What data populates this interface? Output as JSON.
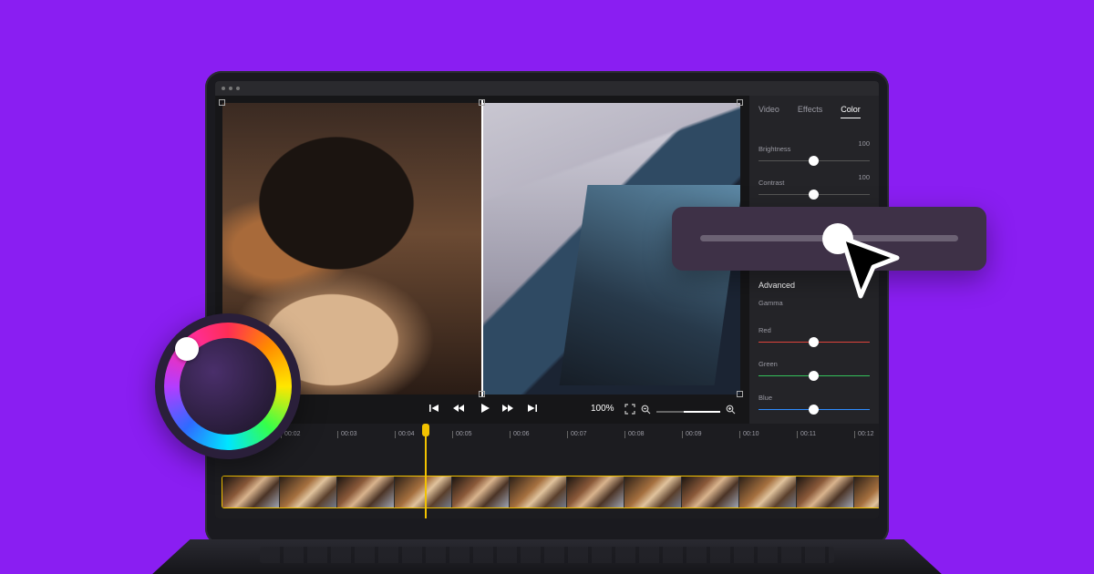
{
  "panel": {
    "tabs": [
      {
        "label": "Video"
      },
      {
        "label": "Effects"
      },
      {
        "label": "Color"
      }
    ],
    "active_tab": "Color",
    "sliders": {
      "brightness": {
        "label": "Brightness",
        "value": "100",
        "level": 0.5
      },
      "contrast": {
        "label": "Contrast",
        "value": "100",
        "level": 0.5
      },
      "red": {
        "label": "Red",
        "level": 0.5,
        "color": "#e0443c"
      },
      "green": {
        "label": "Green",
        "level": 0.5,
        "color": "#35c25b"
      },
      "blue": {
        "label": "Blue",
        "level": 0.5,
        "color": "#2f8cff"
      }
    },
    "advanced_title": "Advanced",
    "gamma_label": "Gamma"
  },
  "transport": {
    "zoom": "100%",
    "icons": [
      "skip-back-icon",
      "rewind-icon",
      "play-icon",
      "fast-forward-icon",
      "skip-forward-icon",
      "fit-screen-icon",
      "zoom-out-icon",
      "zoom-in-icon"
    ]
  },
  "timeline": {
    "ticks": [
      "00:02",
      "00:03",
      "00:04",
      "00:05",
      "00:06",
      "00:07",
      "00:08",
      "00:09",
      "00:10",
      "00:11",
      "00:12"
    ],
    "playhead_color": "#f2c200"
  },
  "callout": {
    "slider_level": 0.52
  },
  "colors": {
    "background": "#8a1ef2",
    "accent": "#f2c200"
  }
}
